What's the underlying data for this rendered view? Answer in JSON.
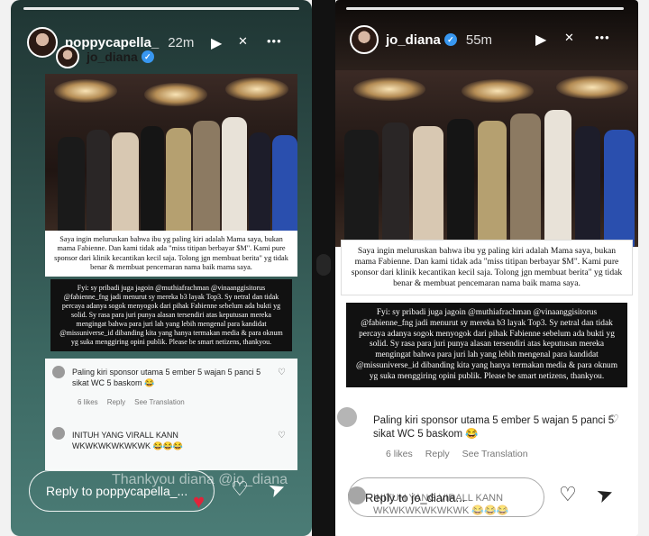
{
  "left": {
    "username": "poppycapella_",
    "time": "22m",
    "mention": "jo_diana",
    "caption_white": "Saya ingin meluruskan bahwa ibu yg paling kiri adalah Mama saya, bukan mama Fabienne. Dan kami tidak ada \"miss titipan berbayar $M\". Kami pure sponsor dari klinik kecantikan kecil saja. Tolong jgn membuat berita\" yg tidak benar & membuat pencemaran nama baik mama saya.",
    "caption_black": "Fyi: sy pribadi juga jagoin @muthiafrachman @vinaanggisitorus @fabienne_fng jadi menurut sy mereka b3 layak Top3. Sy netral dan tidak percaya adanya sogok menyogok dari pihak Fabienne sebelum ada bukti yg solid. Sy rasa para juri punya alasan tersendiri atas keputusan mereka mengingat bahwa para juri lah yang lebih mengenal para kandidat @missuniverse_id dibanding kita yang hanya termakan media & para oknum yg suka menggiring opini publik. Please be smart netizens, thankyou.",
    "comment1": "Paling kiri sponsor utama 5 ember 5 wajan 5 panci 5 sikat WC 5 baskom 😂",
    "likes": "6 likes",
    "reply": "Reply",
    "see_translation": "See Translation",
    "comment2": "INITUH YANG VIRALL KANN WKWKWKWKWKWK 😂😂😂",
    "watermark": "Thankyou diana @jo_diana",
    "reply_placeholder": "Reply to poppycapella_..."
  },
  "right": {
    "username": "jo_diana",
    "time": "55m",
    "caption_white": "Saya ingin meluruskan bahwa ibu yg paling kiri adalah Mama saya, bukan mama Fabienne. Dan kami tidak ada \"miss titipan berbayar $M\". Kami pure sponsor dari klinik kecantikan kecil saja. Tolong jgn membuat berita\" yg tidak benar & membuat pencemaran nama baik mama saya.",
    "caption_black": "Fyi: sy pribadi juga jagoin @muthiafrachman @vinaanggisitorus @fabienne_fng jadi menurut sy mereka b3 layak Top3. Sy netral dan tidak percaya adanya sogok menyogok dari pihak Fabienne sebelum ada bukti yg solid. Sy rasa para juri punya alasan tersendiri atas keputusan mereka mengingat bahwa para juri lah yang lebih mengenal para kandidat @missuniverse_id dibanding kita yang hanya termakan media & para oknum yg suka menggiring opini publik. Please be smart netizens, thankyou.",
    "comment1": "Paling kiri sponsor utama 5 ember 5 wajan 5 panci 5 sikat WC 5 baskom 😂",
    "likes": "6 likes",
    "reply": "Reply",
    "see_translation": "See Translation",
    "comment2": "INITUH YANG VIRALL KANN WKWKWKWKWKWK 😂😂😂",
    "reply_placeholder": "Reply to jo_diana..."
  },
  "icons": {
    "play": "▶",
    "mute": "🔇",
    "more": "•••",
    "heart": "♡",
    "send": "➤",
    "red_heart": "♥"
  }
}
